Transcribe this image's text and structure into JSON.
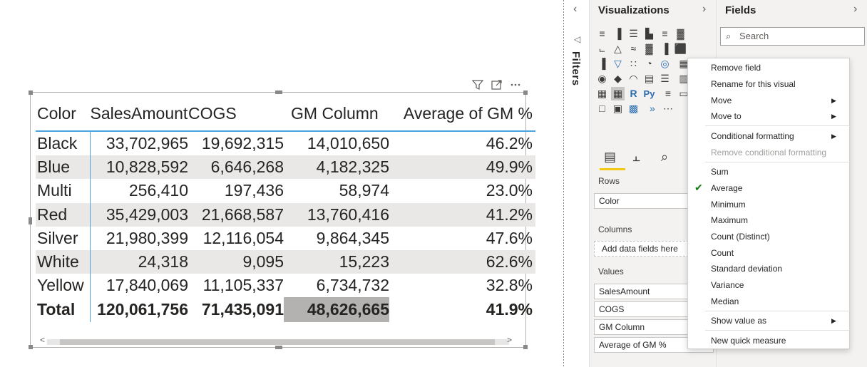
{
  "matrix": {
    "headers": [
      "Color",
      "SalesAmount",
      "COGS",
      "GM Column",
      "Average of GM %"
    ],
    "rows": [
      [
        "Black",
        "33,702,965",
        "19,692,315",
        "14,010,650",
        "46.2%"
      ],
      [
        "Blue",
        "10,828,592",
        "6,646,268",
        "4,182,325",
        "49.9%"
      ],
      [
        "Multi",
        "256,410",
        "197,436",
        "58,974",
        "23.0%"
      ],
      [
        "Red",
        "35,429,003",
        "21,668,587",
        "13,760,416",
        "41.2%"
      ],
      [
        "Silver",
        "21,980,399",
        "12,116,054",
        "9,864,345",
        "47.6%"
      ],
      [
        "White",
        "24,318",
        "9,095",
        "15,223",
        "62.6%"
      ],
      [
        "Yellow",
        "17,840,069",
        "11,105,337",
        "6,734,732",
        "32.8%"
      ]
    ],
    "total": [
      "Total",
      "120,061,756",
      "71,435,091",
      "48,626,665",
      "41.9%"
    ]
  },
  "visual_header_icons": [
    "filter-icon",
    "focus-mode-icon",
    "more-options-icon"
  ],
  "filters_pane": {
    "label": "Filters"
  },
  "visualizations_pane": {
    "title": "Visualizations",
    "build_tabs": [
      "fields-tab",
      "format-tab",
      "analytics-tab"
    ],
    "rows_label": "Rows",
    "rows_fields": [
      "Color"
    ],
    "columns_label": "Columns",
    "columns_placeholder": "Add data fields here",
    "values_label": "Values",
    "values_fields": [
      "SalesAmount",
      "COGS",
      "GM Column",
      "Average of GM %"
    ],
    "visual_icons": [
      "stacked-bar-icon",
      "clustered-bar-icon",
      "stacked-bar-100-icon",
      "stacked-column-icon",
      "clustered-column-icon",
      "stacked-column-100-icon",
      "line-chart-icon",
      "area-chart-icon",
      "stacked-area-icon",
      "line-column-icon",
      "line-clustered-column-icon",
      "ribbon-chart-icon",
      "waterfall-icon",
      "funnel-icon",
      "scatter-icon",
      "pie-icon",
      "donut-icon",
      "treemap-icon",
      "map-icon",
      "filled-map-icon",
      "gauge-icon",
      "card-icon",
      "multirow-card-icon",
      "kpi-icon",
      "slicer-icon",
      "table-icon",
      "matrix-icon",
      "r-visual-icon",
      "python-visual-icon",
      "key-influencers-icon",
      "decomposition-tree-icon",
      "qa-icon",
      "paginated-report-icon",
      "smart-narrative-icon",
      "power-apps-icon",
      "power-automate-icon",
      "more-visuals-icon"
    ]
  },
  "fields_pane": {
    "title": "Fields",
    "search_placeholder": "Search"
  },
  "context_menu": {
    "items": [
      {
        "label": "Remove field"
      },
      {
        "label": "Rename for this visual"
      },
      {
        "label": "Move",
        "submenu": true
      },
      {
        "label": "Move to",
        "submenu": true
      },
      {
        "label": "Conditional formatting",
        "submenu": true
      },
      {
        "label": "Remove conditional formatting",
        "disabled": true
      },
      {
        "label": "Sum"
      },
      {
        "label": "Average",
        "checked": true
      },
      {
        "label": "Minimum"
      },
      {
        "label": "Maximum"
      },
      {
        "label": "Count (Distinct)"
      },
      {
        "label": "Count"
      },
      {
        "label": "Standard deviation"
      },
      {
        "label": "Variance"
      },
      {
        "label": "Median"
      },
      {
        "label": "Show value as",
        "submenu": true
      },
      {
        "label": "New quick measure"
      }
    ]
  },
  "colors": {
    "accent": "#f2c811",
    "selection_blue": "#4aa3df",
    "check": "#107c10"
  }
}
